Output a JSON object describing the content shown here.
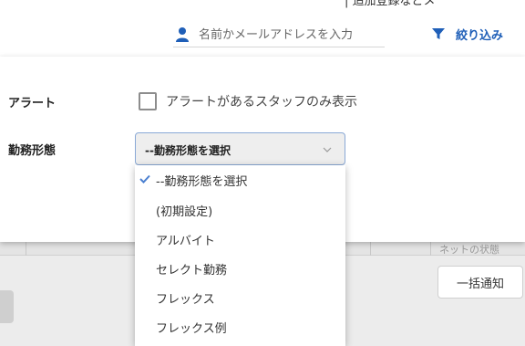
{
  "header": {
    "top_cutoff_text": "| 追加登録などメ",
    "search": {
      "placeholder": "名前かメールアドレスを入力",
      "value": ""
    },
    "filter_button_label": "絞り込み",
    "icons": [
      "person-icon",
      "funnel-icon"
    ]
  },
  "filter_panel": {
    "alert": {
      "label": "アラート",
      "checkbox_label": "アラートがあるスタッフのみ表示",
      "checked": false
    },
    "employment_type": {
      "label": "勤務形態",
      "selected": "--勤務形態を選択",
      "options": [
        {
          "label": "--勤務形態を選択",
          "selected": true
        },
        {
          "label": "(初期設定)",
          "selected": false
        },
        {
          "label": "アルバイト",
          "selected": false
        },
        {
          "label": "セレクト勤務",
          "selected": false
        },
        {
          "label": "フレックス",
          "selected": false
        },
        {
          "label": "フレックス例",
          "selected": false
        }
      ]
    }
  },
  "background": {
    "table_edge_text": "ネットの状態",
    "bulk_notify_label": "一括通知"
  },
  "colors": {
    "accent": "#1f5fb8",
    "select_border": "#8aa9d6",
    "checkmark": "#4a7fd0"
  }
}
